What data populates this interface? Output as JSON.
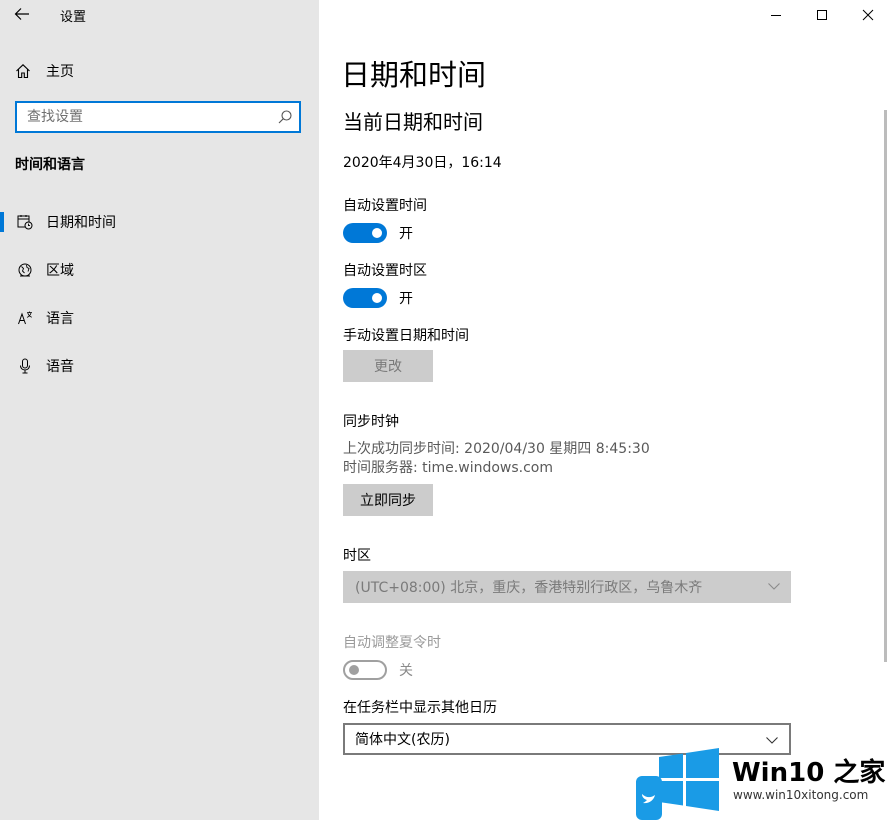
{
  "window": {
    "title": "设置",
    "controls": [
      "minimize-icon",
      "maximize-icon",
      "close-icon"
    ]
  },
  "sidebar": {
    "home_label": "主页",
    "search_placeholder": "查找设置",
    "section_title": "时间和语言",
    "items": [
      {
        "label": "日期和时间",
        "icon": "calendar-clock-icon",
        "selected": true
      },
      {
        "label": "区域",
        "icon": "globe-icon",
        "selected": false
      },
      {
        "label": "语言",
        "icon": "language-icon",
        "selected": false
      },
      {
        "label": "语音",
        "icon": "microphone-icon",
        "selected": false
      }
    ]
  },
  "main": {
    "page_title": "日期和时间",
    "current_heading": "当前日期和时间",
    "current_datetime": "2020年4月30日，16:14",
    "auto_time": {
      "label": "自动设置时间",
      "state": "开",
      "on": true
    },
    "auto_timezone": {
      "label": "自动设置时区",
      "state": "开",
      "on": true
    },
    "manual": {
      "label": "手动设置日期和时间",
      "button": "更改"
    },
    "sync": {
      "heading": "同步时钟",
      "last_sync": "上次成功同步时间: 2020/04/30 星期四 8:45:30",
      "server": "时间服务器: time.windows.com",
      "button": "立即同步"
    },
    "timezone": {
      "label": "时区",
      "value": "(UTC+08:00) 北京，重庆，香港特别行政区，乌鲁木齐"
    },
    "dst": {
      "label": "自动调整夏令时",
      "state": "关",
      "on": false
    },
    "calendar": {
      "label": "在任务栏中显示其他日历",
      "value": "简体中文(农历)"
    }
  },
  "watermark": {
    "name": "Win10 之家",
    "url": "www.win10xitong.com"
  },
  "colors": {
    "accent": "#0078d7",
    "sidebar_bg": "#e6e6e6",
    "button_bg": "#cccccc",
    "watermark_blue": "#1a9be6"
  }
}
